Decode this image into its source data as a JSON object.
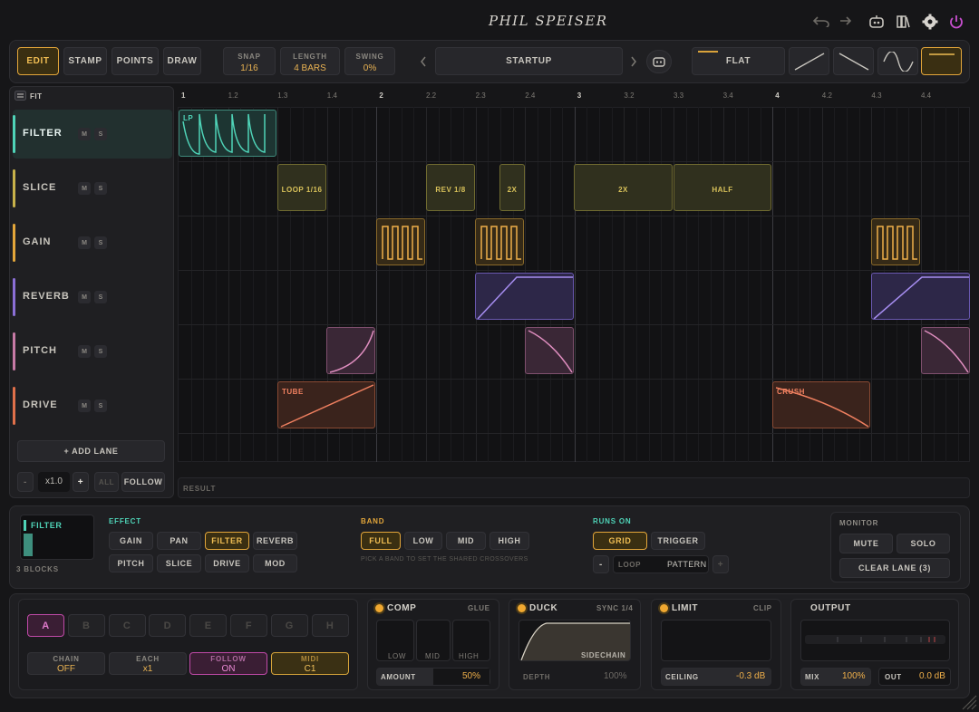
{
  "brand": {
    "logo": "PHIL SPEISER",
    "accent": "#f0b04a"
  },
  "toolbar": {
    "modes": [
      "EDIT",
      "STAMP",
      "POINTS",
      "DRAW"
    ],
    "active_mode": "EDIT",
    "snap": {
      "label": "SNAP",
      "value": "1/16"
    },
    "length": {
      "label": "LENGTH",
      "value": "4 BARS"
    },
    "swing": {
      "label": "SWING",
      "value": "0%"
    },
    "preset": "STARTUP",
    "curve": "FLAT"
  },
  "lanes_panel": {
    "fit": "FIT",
    "lanes": [
      {
        "name": "FILTER",
        "color": "#4fd4b8",
        "mute": "M",
        "solo": "S"
      },
      {
        "name": "SLICE",
        "color": "#c8b24a",
        "mute": "M",
        "solo": "S"
      },
      {
        "name": "GAIN",
        "color": "#e3a63a",
        "mute": "M",
        "solo": "S"
      },
      {
        "name": "REVERB",
        "color": "#8b6fd6",
        "mute": "M",
        "solo": "S"
      },
      {
        "name": "PITCH",
        "color": "#c77aa6",
        "mute": "M",
        "solo": "S"
      },
      {
        "name": "DRIVE",
        "color": "#e0704a",
        "mute": "M",
        "solo": "S"
      }
    ],
    "add_lane": "+ ADD LANE",
    "minus": "-",
    "zoom": "x1.0",
    "plus": "+",
    "all": "ALL",
    "follow": "FOLLOW"
  },
  "ruler": [
    "1",
    "1.2",
    "1.3",
    "1.4",
    "2",
    "2.2",
    "2.3",
    "2.4",
    "3",
    "3.2",
    "3.3",
    "3.4",
    "4",
    "4.2",
    "4.3",
    "4.4"
  ],
  "blocks": {
    "filter": "LP",
    "slice": [
      "LOOP 1/16",
      "REV 1/8",
      "2X",
      "2X",
      "HALF"
    ],
    "drive": [
      "TUBE",
      "CRUSH"
    ]
  },
  "result": "RESULT",
  "inspector": {
    "lane": "FILTER",
    "blocks": "3 BLOCKS",
    "effect_label": "EFFECT",
    "effects": [
      "GAIN",
      "PAN",
      "FILTER",
      "REVERB",
      "PITCH",
      "SLICE",
      "DRIVE",
      "MOD"
    ],
    "effect_active": "FILTER",
    "band_label": "BAND",
    "bands": [
      "FULL",
      "LOW",
      "MID",
      "HIGH"
    ],
    "band_active": "FULL",
    "band_hint": "PICK A BAND TO SET THE SHARED CROSSOVERS",
    "runs_label": "RUNS ON",
    "runs": [
      "GRID",
      "TRIGGER"
    ],
    "runs_active": "GRID",
    "loop_minus": "-",
    "loop_label": "LOOP",
    "loop_value": "PATTERN",
    "loop_plus": "+",
    "monitor_label": "MONITOR",
    "mute": "MUTE",
    "solo": "SOLO",
    "clear": "CLEAR LANE (3)"
  },
  "patterns": {
    "slots": [
      "A",
      "B",
      "C",
      "D",
      "E",
      "F",
      "G",
      "H"
    ],
    "active": "A",
    "chain": {
      "label": "CHAIN",
      "value": "OFF"
    },
    "each": {
      "label": "EACH",
      "value": "x1"
    },
    "follow": {
      "label": "FOLLOW",
      "value": "ON"
    },
    "midi": {
      "label": "MIDI",
      "value": "C1"
    }
  },
  "comp": {
    "title": "COMP",
    "mode": "GLUE",
    "bands": [
      "LOW",
      "MID",
      "HIGH"
    ],
    "amount_label": "AMOUNT",
    "amount": "50%"
  },
  "duck": {
    "title": "DUCK",
    "sync": "SYNC 1/4",
    "sidechain": "SIDECHAIN",
    "depth_label": "DEPTH",
    "depth": "100%"
  },
  "limit": {
    "title": "LIMIT",
    "mode": "CLIP",
    "ceiling_label": "CEILING",
    "ceiling": "-0.3 dB"
  },
  "output": {
    "title": "OUTPUT",
    "mix_label": "MIX",
    "mix": "100%",
    "out_label": "OUT",
    "out": "0.0 dB"
  }
}
